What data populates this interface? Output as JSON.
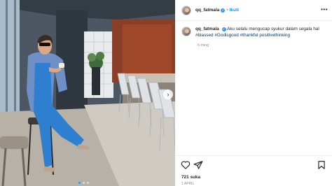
{
  "post": {
    "username": "qq_fatmala",
    "follow_label": "Ikuti",
    "separator": "•",
    "more_label": "•••",
    "caption_text": "Aku selalu mengucap syukur dalam segala hal",
    "hashtags": [
      "#blassed",
      "#Godisgood",
      "#thankful",
      "positivethinking"
    ],
    "time_ago": "6 ming",
    "likes": "721 suka",
    "date": "1 April"
  },
  "icons": {
    "verified": "verified-badge-icon",
    "heart": "heart-icon",
    "share": "send-icon",
    "bookmark": "bookmark-icon",
    "arrow": "chevron-right-icon"
  },
  "colors": {
    "link": "#0095f6",
    "hashtag": "#00376b",
    "verified": "#3897f0",
    "muted": "#8e8e8e"
  },
  "carousel": {
    "slides": 3,
    "active": 1
  }
}
